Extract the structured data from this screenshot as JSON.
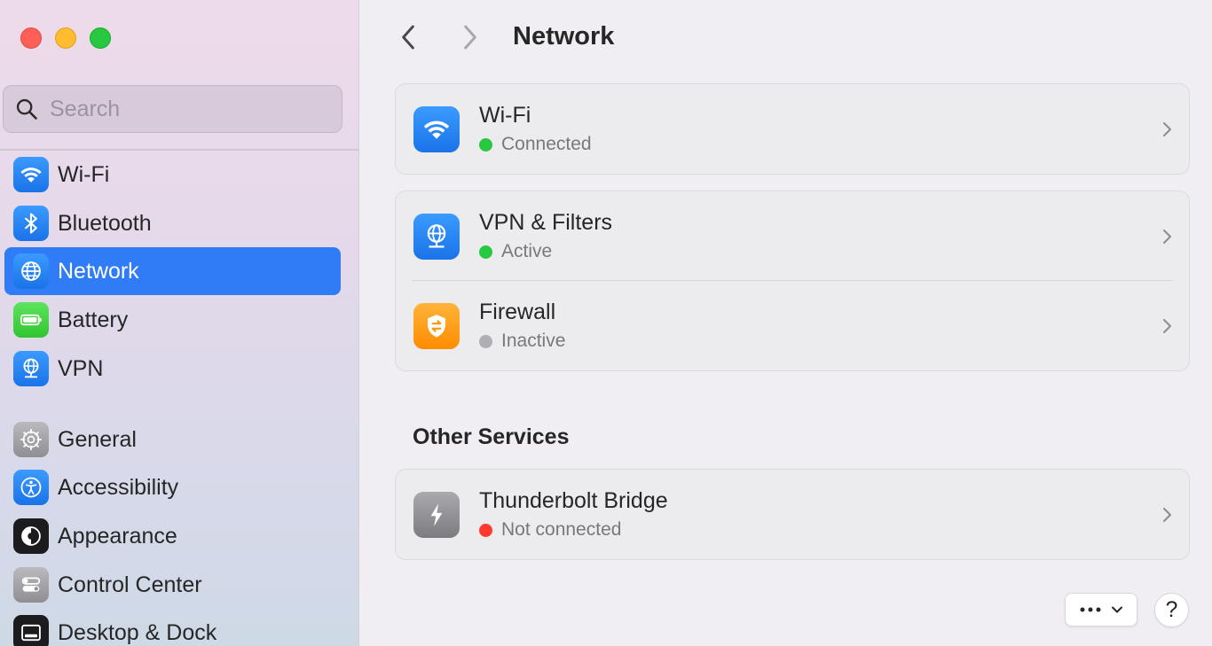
{
  "window": {
    "controls": [
      "close",
      "minimize",
      "zoom"
    ]
  },
  "sidebar": {
    "search": {
      "placeholder": "Search",
      "value": ""
    },
    "items": [
      {
        "label": "Wi-Fi",
        "icon": "wifi-icon",
        "color": "#1a73e8",
        "active": false
      },
      {
        "label": "Bluetooth",
        "icon": "bluetooth-icon",
        "color": "#1a73e8",
        "active": false
      },
      {
        "label": "Network",
        "icon": "globe-icon",
        "color": "#1a73e8",
        "active": true
      },
      {
        "label": "Battery",
        "icon": "battery-icon",
        "color": "#2fc52f",
        "active": false
      },
      {
        "label": "VPN",
        "icon": "vpn-globe-icon",
        "color": "#1a73e8",
        "active": false
      },
      {
        "label": "General",
        "icon": "gear-icon",
        "color": "#8e8e93",
        "active": false
      },
      {
        "label": "Accessibility",
        "icon": "accessibility-icon",
        "color": "#1a73e8",
        "active": false
      },
      {
        "label": "Appearance",
        "icon": "appearance-icon",
        "color": "#1c1c1e",
        "active": false
      },
      {
        "label": "Control Center",
        "icon": "control-center-icon",
        "color": "#8e8e93",
        "active": false
      },
      {
        "label": "Desktop & Dock",
        "icon": "dock-icon",
        "color": "#1c1c1e",
        "active": false
      }
    ]
  },
  "main": {
    "title": "Network",
    "back_icon": "chevron-left-icon",
    "forward_icon": "chevron-right-icon",
    "services": [
      {
        "name": "Wi-Fi",
        "status": "Connected",
        "status_color": "#28c840",
        "icon": "wifi-icon"
      },
      {
        "name": "VPN & Filters",
        "status": "Active",
        "status_color": "#28c840",
        "icon": "vpn-globe-icon"
      },
      {
        "name": "Firewall",
        "status": "Inactive",
        "status_color": "#b0aeb3",
        "icon": "firewall-shield-icon"
      }
    ],
    "other_services_title": "Other Services",
    "other_services": [
      {
        "name": "Thunderbolt Bridge",
        "status": "Not connected",
        "status_color": "#ff3b30",
        "icon": "thunderbolt-icon"
      }
    ],
    "more_button": {
      "icon": "ellipsis-icon",
      "dropdown_icon": "chevron-down-icon"
    },
    "help_button": {
      "label": "?"
    }
  }
}
